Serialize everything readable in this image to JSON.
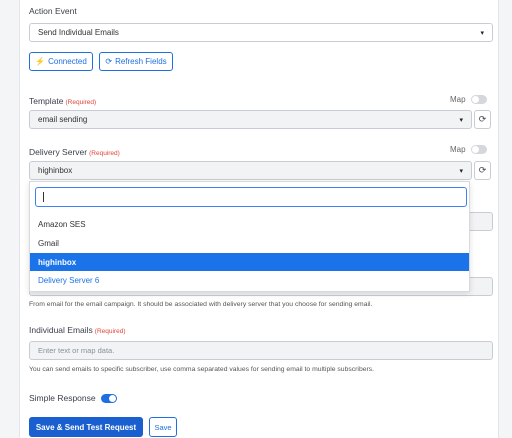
{
  "action_event": {
    "label": "Action Event",
    "value": "Send Individual Emails"
  },
  "buttons": {
    "connected": "Connected",
    "refresh_fields": "Refresh Fields"
  },
  "template": {
    "label": "Template",
    "required": "(Required)",
    "map": "Map",
    "value": "email sending"
  },
  "delivery_server": {
    "label": "Delivery Server",
    "required": "(Required)",
    "map": "Map",
    "value": "highinbox",
    "options": [
      "Amazon SES",
      "Gmail",
      "highinbox",
      "Delivery Server 6"
    ],
    "selected_option": "highinbox"
  },
  "from_email": {
    "help": "From email for the email campaign. It should be associated with delivery server that you choose for sending email."
  },
  "individual_emails": {
    "label": "Individual Emails",
    "required": "(Required)",
    "placeholder": "Enter text or map data.",
    "help": "You can send emails to specific subscriber, use comma separated values for sending email to multiple subscribers."
  },
  "simple_response": {
    "label": "Simple Response",
    "enabled": true
  },
  "footer": {
    "save_test": "Save & Send Test Request",
    "save": "Save"
  },
  "colors": {
    "primary": "#1a5fcf",
    "accent": "#1a73e8",
    "required": "#e0453a"
  }
}
